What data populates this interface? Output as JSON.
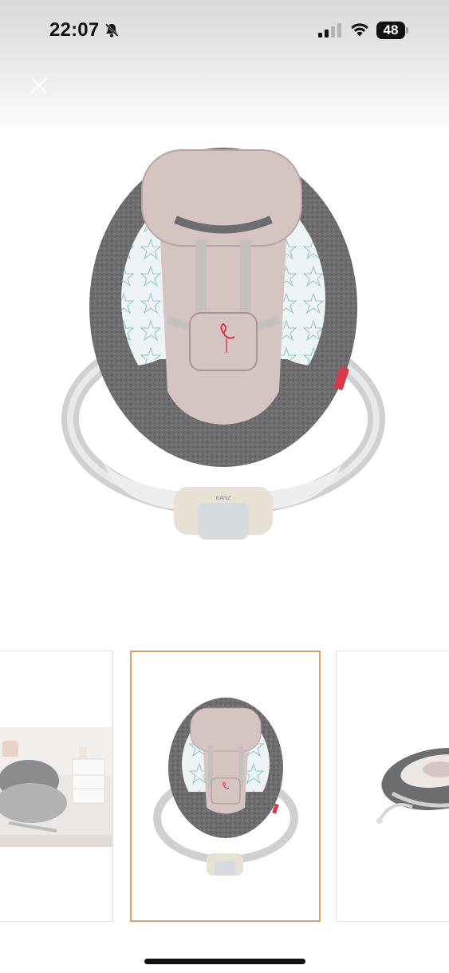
{
  "status_bar": {
    "time": "22:07",
    "battery_level": "48",
    "icons": [
      "bell-slash-icon",
      "signal-icon",
      "wifi-icon",
      "battery-icon"
    ]
  },
  "viewer": {
    "close_icon": "close-icon",
    "main_image": {
      "subject": "baby-bouncer-product-photo",
      "brand_text": "KANZ"
    },
    "thumbnails": [
      {
        "subject": "bouncer-in-nursery-room",
        "selected": false
      },
      {
        "subject": "bouncer-front-view",
        "selected": true
      },
      {
        "subject": "bouncer-side-view",
        "selected": false
      }
    ],
    "selected_border_color": "#d3a36a"
  },
  "colors": {
    "fabric_gray": "#6d6d70",
    "cushion_pink": "#d6c4c2",
    "accent_red": "#d6394b",
    "frame_silver": "#cfd0d2"
  }
}
